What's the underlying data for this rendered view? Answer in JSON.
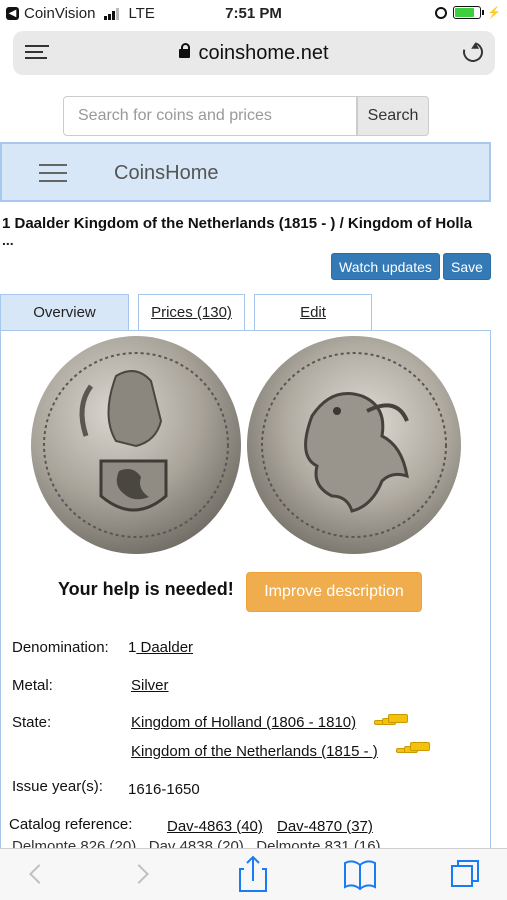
{
  "status_bar": {
    "carrier": "CoinVision",
    "network": "LTE",
    "time": "7:51 PM"
  },
  "browser": {
    "url": "coinshome.net"
  },
  "search": {
    "placeholder": "Search for coins and prices",
    "button_label": "Search"
  },
  "site": {
    "brand": "CoinsHome"
  },
  "coin": {
    "title": "1 Daalder Kingdom of the Netherlands (1815 - ) / Kingdom of Holla",
    "title_overflow": "...",
    "watch_label": "Watch updates",
    "save_label": "Save"
  },
  "tabs": [
    {
      "label": "Overview"
    },
    {
      "label": "Prices (130)"
    },
    {
      "label": "Edit"
    }
  ],
  "help": {
    "text": "Your help is needed!",
    "button_label": "Improve description"
  },
  "details": {
    "denomination_label": "Denomination:",
    "denomination_prefix": "1",
    "denomination_value": " Daalder",
    "metal_label": "Metal:",
    "metal_value": "Silver",
    "state_label": "State:",
    "states": [
      "Kingdom of Holland (1806 - 1810)",
      "Kingdom of the Netherlands (1815 - )"
    ],
    "issue_label": "Issue year(s):",
    "issue_value": "1616-1650",
    "catalog_label": "Catalog reference:",
    "catalog_refs": [
      "Dav-4863 (40)",
      "Dav-4870 (37)"
    ],
    "catalog_refs_partial": "Delmonte 826 (20)   Dav 4838 (20)   Delmonte 831 (16)"
  },
  "icons": {
    "money": "money-stack-icon",
    "colors": {
      "link_button": "#337ab7",
      "warning_button": "#f0ad4e",
      "nav_bg": "#d7e7f7"
    }
  }
}
